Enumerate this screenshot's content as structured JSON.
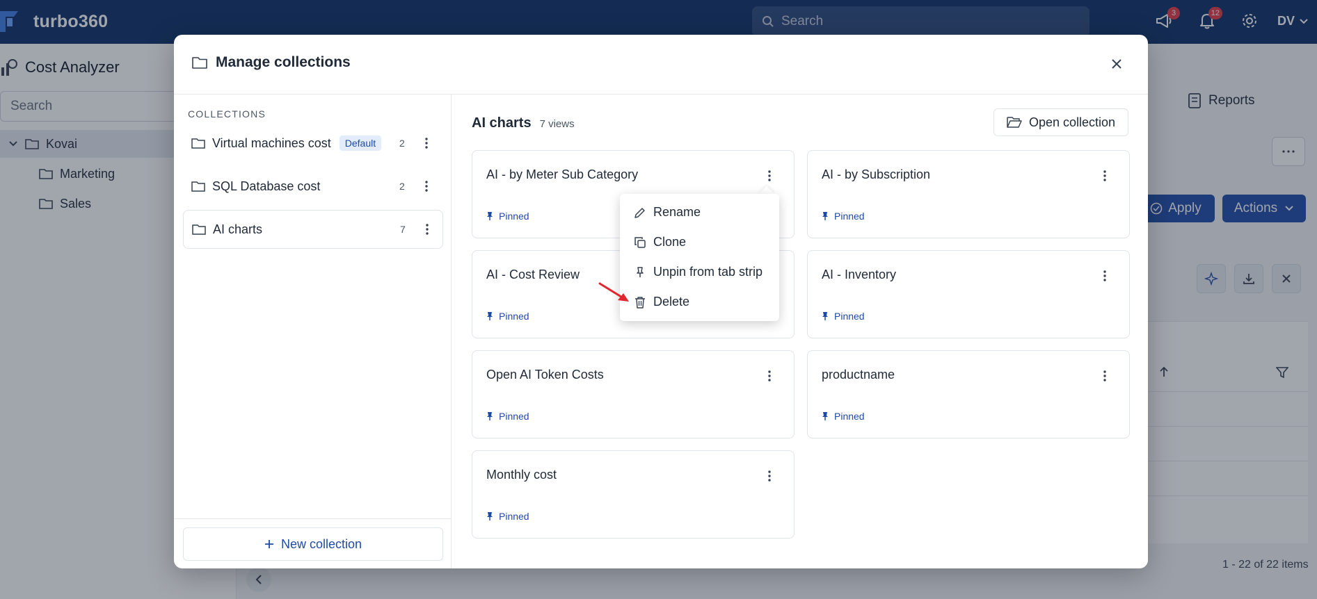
{
  "app": {
    "brand": "turbo360",
    "search_placeholder": "Search",
    "announcements_badge": "3",
    "notifications_badge": "12",
    "user_initials": "DV"
  },
  "left_pane": {
    "title": "Cost Analyzer",
    "search_placeholder": "Search",
    "tree": [
      {
        "label": "Kovai"
      },
      {
        "label": "Marketing"
      },
      {
        "label": "Sales"
      }
    ]
  },
  "right_pane": {
    "reports_tab": "Reports",
    "apply_label": "Apply",
    "actions_label": "Actions",
    "pager_text": "1 - 22 of 22 items"
  },
  "modal": {
    "title": "Manage collections",
    "collections_heading": "COLLECTIONS",
    "collections": [
      {
        "name": "Virtual machines cost",
        "badge": "Default",
        "count": "2"
      },
      {
        "name": "SQL Database cost",
        "badge": "",
        "count": "2"
      },
      {
        "name": "AI charts",
        "badge": "",
        "count": "7"
      }
    ],
    "new_collection_label": "New collection",
    "selected_collection": {
      "name": "AI charts",
      "views": "7 views"
    },
    "open_collection_label": "Open collection",
    "views": [
      {
        "title": "AI - by Meter Sub Category",
        "status": "Pinned"
      },
      {
        "title": "AI - by Subscription",
        "status": "Pinned"
      },
      {
        "title": "AI - Cost Review",
        "status": "Pinned"
      },
      {
        "title": "AI - Inventory",
        "status": "Pinned"
      },
      {
        "title": "Open AI Token Costs",
        "status": "Pinned"
      },
      {
        "title": "productname",
        "status": "Pinned"
      },
      {
        "title": "Monthly cost",
        "status": "Pinned"
      }
    ],
    "context_menu": {
      "rename": "Rename",
      "clone": "Clone",
      "unpin": "Unpin from tab strip",
      "delete": "Delete"
    }
  },
  "colors": {
    "topbar": "#0d2f66",
    "accent": "#1e4aa8",
    "annotation_arrow": "#e0262f"
  }
}
